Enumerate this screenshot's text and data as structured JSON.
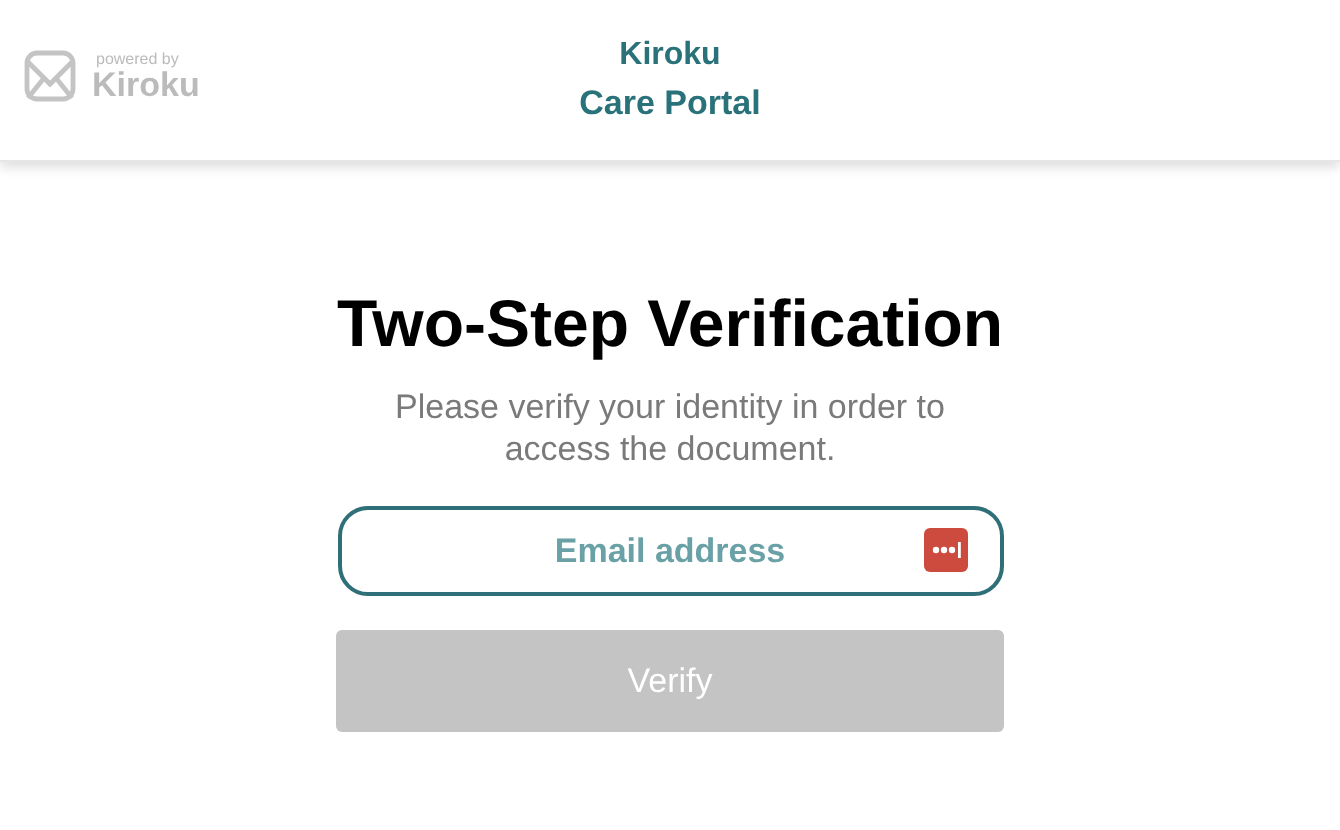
{
  "header": {
    "logo": {
      "caption": "powered by",
      "name": "Kiroku"
    },
    "title": "Kiroku",
    "subtitle": "Care Portal"
  },
  "heading": "Two-Step Verification",
  "message": "Please verify your identity in order to access the document.",
  "email_field": {
    "placeholder": "Email address"
  },
  "verify_button": {
    "label": "Verify",
    "disabled": true
  }
}
